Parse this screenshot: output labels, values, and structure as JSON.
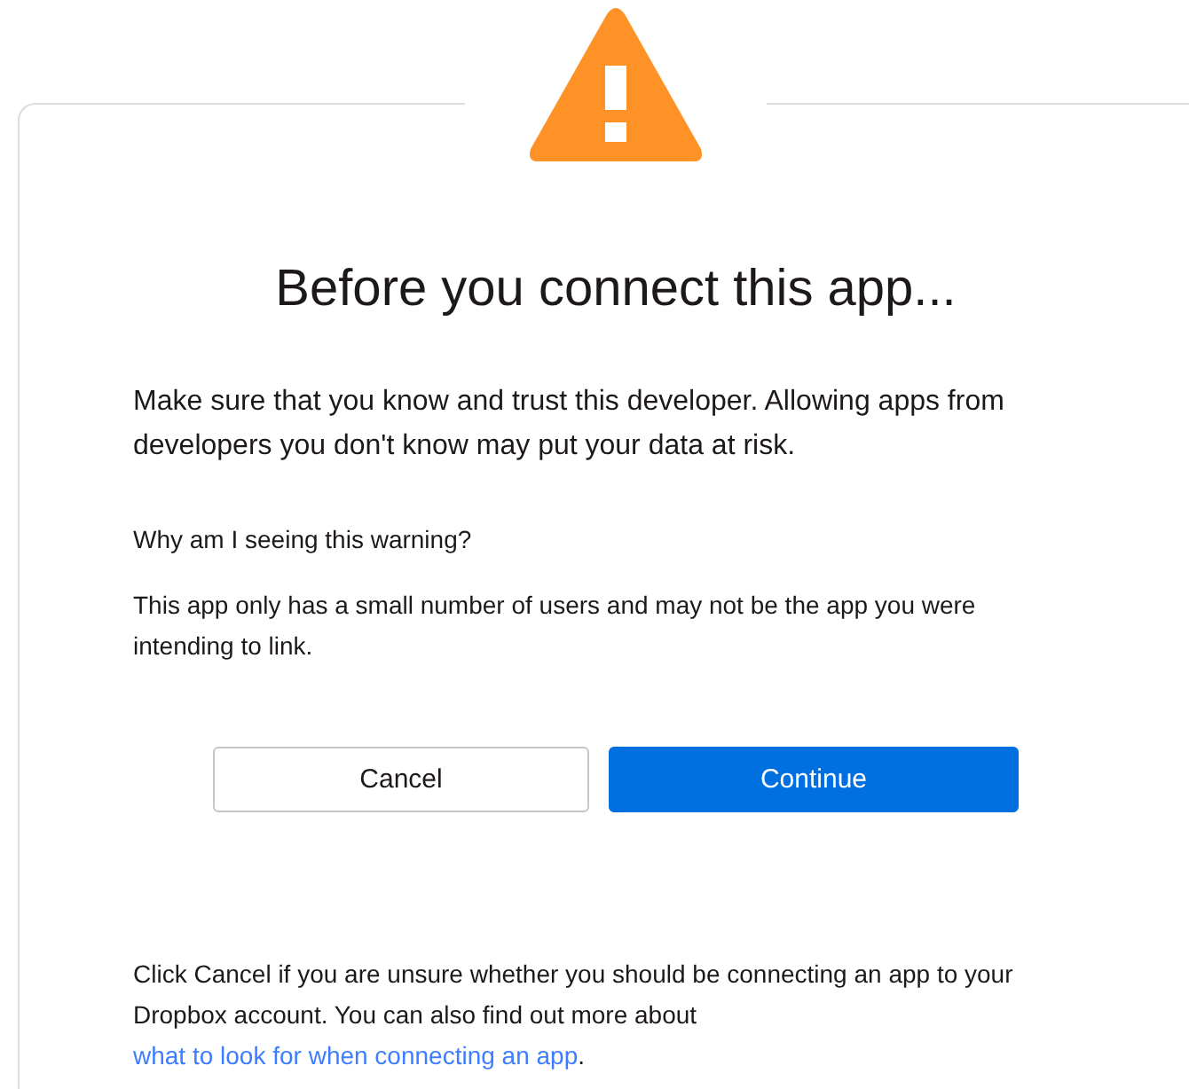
{
  "dialog": {
    "title": "Before you connect this app...",
    "message": "Make sure that you know and trust this developer. Allowing apps from developers you don't know may put your data at risk.",
    "why_heading": "Why am I seeing this warning?",
    "why_text": "This app only has a small number of users and may not be the app you were intending to link.",
    "buttons": [
      {
        "label": "Cancel",
        "kind": "secondary"
      },
      {
        "label": "Continue",
        "kind": "primary"
      }
    ],
    "footer": {
      "text": "Click Cancel if you are unsure whether you should be connecting an app to your Dropbox account. You can also find out more about",
      "link": "what to look for when connecting an app",
      "end": "."
    }
  }
}
